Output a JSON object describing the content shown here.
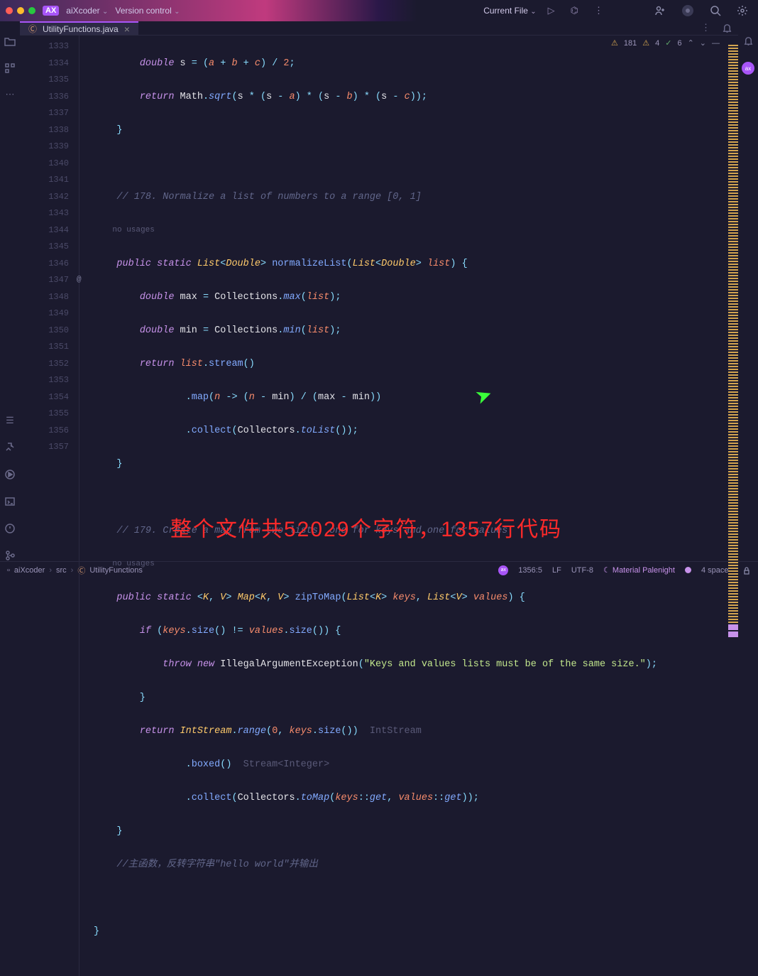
{
  "title_bar": {
    "brand": "AX",
    "project": "aiXcoder",
    "vcs": "Version control",
    "run_target": "Current File"
  },
  "tab": {
    "filename": "UtilityFunctions.java"
  },
  "badges": {
    "warn1": "181",
    "warn2": "4",
    "check": "6"
  },
  "gutter_lines": [
    "1333",
    "1334",
    "1335",
    "1336",
    "1337",
    "",
    "1338",
    "1339",
    "1340",
    "1341",
    "1342",
    "1343",
    "1344",
    "1345",
    "1346",
    "",
    "1347",
    "1348",
    "1349",
    "1350",
    "1351",
    "1352",
    "1353",
    "1354",
    "1355",
    "1356",
    "1357"
  ],
  "code": {
    "l1333": {
      "kw": "double",
      "var": "s",
      "op1": " = (",
      "a": "a",
      "op2": " + ",
      "b": "b",
      "op3": " + ",
      "c": "c",
      "op4": ") / ",
      "n": "2",
      "end": ";"
    },
    "l1334": {
      "kw": "return",
      "cls": "Math",
      "dot": ".",
      "fn": "sqrt",
      "open": "(",
      "var": "s",
      "o1": " * (",
      "s1": "s",
      "o2": " - ",
      "a": "a",
      "o3": ") * (",
      "s2": "s",
      "o4": " - ",
      "b": "b",
      "o5": ") * (",
      "s3": "s",
      "o6": " - ",
      "c": "c",
      "end": "));"
    },
    "l1335": "    }",
    "l1337": "    // 178. Normalize a list of numbers to a range [0, 1]",
    "nousage1": "    no usages",
    "l1338": {
      "pre": "    ",
      "pub": "public",
      "sp1": " ",
      "stat": "static",
      "sp2": " ",
      "lst": "List",
      "lt": "<",
      "dbl": "Double",
      "gt": ">",
      "sp3": " ",
      "fn": "normalizeList",
      "open": "(",
      "plst": "List",
      "plt": "<",
      "pdbl": "Double",
      "pgt": ">",
      "sp4": " ",
      "prm": "list",
      "end": ") {"
    },
    "l1339": {
      "pre": "        ",
      "kw": "double",
      "sp": " ",
      "var": "max",
      "eq": " = ",
      "cls": "Collections",
      "dot": ".",
      "fn": "max",
      "open": "(",
      "arg": "list",
      "end": ");"
    },
    "l1340": {
      "pre": "        ",
      "kw": "double",
      "sp": " ",
      "var": "min",
      "eq": " = ",
      "cls": "Collections",
      "dot": ".",
      "fn": "min",
      "open": "(",
      "arg": "list",
      "end": ");"
    },
    "l1341": {
      "pre": "        ",
      "kw": "return",
      "sp": " ",
      "var": "list",
      "dot": ".",
      "fn": "stream",
      "end": "()"
    },
    "l1342": {
      "pre": "                .",
      "fn": "map",
      "open": "(",
      "p": "n",
      "arrow": " -> (",
      "n": "n",
      "o1": " - ",
      "min": "min",
      "o2": ") / (",
      "max": "max",
      "o3": " - ",
      "min2": "min",
      "end": "))"
    },
    "l1343": {
      "pre": "                .",
      "fn": "collect",
      "open": "(",
      "cls": "Collectors",
      "dot": ".",
      "fn2": "toList",
      "end": "());"
    },
    "l1344": "    }",
    "l1346": "    // 179. Create a map from two lists, one for keys and one for values",
    "nousage2": "    no usages",
    "l1347": {
      "pre": "    ",
      "pub": "public",
      "sp1": " ",
      "stat": "static",
      "sp2": " <",
      "k": "K",
      "c1": ", ",
      "v": "V",
      "gt1": "> ",
      "map": "Map",
      "lt": "<",
      "k2": "K",
      "c2": ", ",
      "v2": "V",
      "gt2": ">",
      "sp3": " ",
      "fn": "zipToMap",
      "open": "(",
      "plst": "List",
      "plt": "<",
      "pk": "K",
      "pgt": ">",
      "sp4": " ",
      "prm1": "keys",
      "c3": ", ",
      "plst2": "List",
      "plt2": "<",
      "pv": "V",
      "pgt2": ">",
      "sp5": " ",
      "prm2": "values",
      "end": ") {"
    },
    "l1348": {
      "pre": "        ",
      "kw": "if",
      "sp": " (",
      "v1": "keys",
      "d1": ".",
      "fn1": "size",
      "p1": "() != ",
      "v2": "values",
      "d2": ".",
      "fn2": "size",
      "end": "()) {"
    },
    "l1349": {
      "pre": "            ",
      "th": "throw",
      "sp": " ",
      "nw": "new",
      "sp2": " ",
      "cls": "IllegalArgumentException",
      "open": "(",
      "str": "\"Keys and values lists must be of the same size.\"",
      "end": ");"
    },
    "l1350": "        }",
    "l1351": {
      "pre": "        ",
      "kw": "return",
      "sp": " ",
      "cls": "IntStream",
      "dot": ".",
      "fn": "range",
      "open": "(",
      "z": "0",
      "c": ", ",
      "v": "keys",
      "d2": ".",
      "fn2": "size",
      "end": "())",
      "hint": "  IntStream"
    },
    "l1352": {
      "pre": "                .",
      "fn": "boxed",
      "end": "()",
      "hint": "  Stream<Integer>"
    },
    "l1353": {
      "pre": "                .",
      "fn": "collect",
      "open": "(",
      "cls": "Collectors",
      "dot": ".",
      "fn2": "toMap",
      "open2": "(",
      "v1": "keys",
      "cc": "::",
      "g1": "get",
      "c": ", ",
      "v2": "values",
      "cc2": "::",
      "g2": "get",
      "end": "));"
    },
    "l1354": "    }",
    "l1355": "    //主函数，反转字符串\"hello world\"并输出",
    "l1357": "}"
  },
  "overlay": "整个文件共52029个字符，1357行代码",
  "status": {
    "project": "aiXcoder",
    "src": "src",
    "file": "UtilityFunctions",
    "pos": "1356:5",
    "eol": "LF",
    "enc": "UTF-8",
    "theme": "Material Palenight",
    "indent": "4 spaces"
  }
}
